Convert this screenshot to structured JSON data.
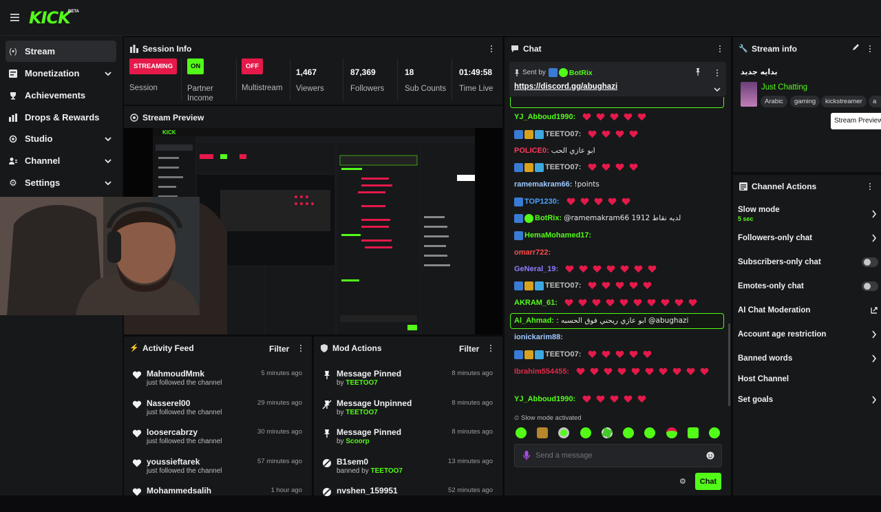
{
  "brand": {
    "logo": "KICK",
    "beta": "BETA"
  },
  "sidebar": {
    "items": [
      {
        "label": "Stream",
        "icon": "stream-icon"
      },
      {
        "label": "Monetization",
        "icon": "monetization-icon"
      },
      {
        "label": "Achievements",
        "icon": "trophy-icon"
      },
      {
        "label": "Drops & Rewards",
        "icon": "drops-icon"
      },
      {
        "label": "Studio",
        "icon": "studio-icon"
      },
      {
        "label": "Channel",
        "icon": "channel-icon"
      },
      {
        "label": "Settings",
        "icon": "gear-icon"
      }
    ]
  },
  "session": {
    "title": "Session Info",
    "stats": [
      {
        "badge": "STREAMING",
        "label": "Session"
      },
      {
        "badge": "ON",
        "label": "Partner Income"
      },
      {
        "badge": "OFF",
        "label": "Multistream"
      },
      {
        "value": "1,467",
        "label": "Viewers"
      },
      {
        "value": "87,369",
        "label": "Followers"
      },
      {
        "value": "18",
        "label": "Sub Counts"
      },
      {
        "value": "01:49:58",
        "label": "Time Live"
      }
    ]
  },
  "preview": {
    "title": "Stream Preview"
  },
  "activity": {
    "title": "Activity Feed",
    "filter": "Filter",
    "rows": [
      {
        "name": "MahmoudMmk",
        "sub": "just followed the channel",
        "time": "5 minutes ago"
      },
      {
        "name": "Nasserel00",
        "sub": "just followed the channel",
        "time": "29 minutes ago"
      },
      {
        "name": "loosercabrzy",
        "sub": "just followed the channel",
        "time": "30 minutes ago"
      },
      {
        "name": "youssieftarek",
        "sub": "just followed the channel",
        "time": "57 minutes ago"
      },
      {
        "name": "Mohammedsalih",
        "sub": "",
        "time": "1 hour ago"
      }
    ]
  },
  "mod": {
    "title": "Mod Actions",
    "filter": "Filter",
    "rows": [
      {
        "name": "Message Pinned",
        "by": "by",
        "who": "TEETOO7",
        "time": "8 minutes ago"
      },
      {
        "name": "Message Unpinned",
        "by": "by",
        "who": "TEETOO7",
        "time": "8 minutes ago"
      },
      {
        "name": "Message Pinned",
        "by": "by",
        "who": "Scoorp",
        "time": "8 minutes ago"
      },
      {
        "name": "B1sem0",
        "by": "banned by",
        "who": "TEETOO7",
        "time": "13 minutes ago"
      },
      {
        "name": "nvshen_159951",
        "by": "",
        "who": "",
        "time": "52 minutes ago"
      }
    ]
  },
  "chat": {
    "title": "Chat",
    "pinned": {
      "sent_by": "Sent by",
      "user": "BotRix",
      "link": "https://discord.gg/abughazi"
    },
    "messages": [
      {
        "user": "YJ_Abboud1990:",
        "text": "",
        "hearts": 5,
        "color": "#53fc18"
      },
      {
        "user": "TEETO07:",
        "text": "",
        "hearts": 4,
        "color": "#c0c0c0"
      },
      {
        "user": "POLICE0:",
        "text": "ابو عازي الحب",
        "hearts": 0,
        "color": "#ff3b5c"
      },
      {
        "user": "TEETO07:",
        "text": "",
        "hearts": 4,
        "color": "#c0c0c0"
      },
      {
        "user": "ramemakram66:",
        "text": "!points",
        "hearts": 0,
        "color": "#9fc8ff"
      },
      {
        "user": "TOP1230:",
        "text": "",
        "hearts": 5,
        "color": "#4aa3ff"
      },
      {
        "user": "BotRix:",
        "text": "@ramemakram66 لديه نقاط 1912",
        "hearts": 0,
        "color": "#53fc18"
      },
      {
        "user": "HemaMohamed17:",
        "text": "",
        "hearts": 0,
        "color": "#53fc18"
      },
      {
        "user": "omarr722:",
        "text": "",
        "hearts": 0,
        "color": "#ff4d4d"
      },
      {
        "user": "GeNeral_19:",
        "text": "",
        "hearts": 7,
        "color": "#8c7dff"
      },
      {
        "user": "TEETO07:",
        "text": "",
        "hearts": 5,
        "color": "#c0c0c0"
      },
      {
        "user": "AKRAM_61:",
        "text": "",
        "hearts": 10,
        "color": "#53fc18"
      },
      {
        "user": "Al_Ahmad:",
        "text": ": ابو عازي ريحني فوق الحسبه @abughazi",
        "hearts": 0,
        "color": "#53fc18"
      },
      {
        "user": "ionickarim88:",
        "text": "",
        "hearts": 0,
        "color": "#9fc8ff"
      },
      {
        "user": "TEETO07:",
        "text": "",
        "hearts": 5,
        "color": "#c0c0c0"
      },
      {
        "user": "Ibrahim554455:",
        "text": "",
        "hearts": 10,
        "color": "#e0284a"
      },
      {
        "user": "YJ_Abboud1990:",
        "text": "",
        "hearts": 5,
        "color": "#53fc18"
      }
    ],
    "slow_mode": "Slow mode activated",
    "input_placeholder": "Send a message",
    "send": "Chat"
  },
  "stream_info": {
    "title": "Stream info",
    "stream_title": "بدايه جديد",
    "category": "Just Chatting",
    "tags": [
      "Arabic",
      "gaming",
      "kickstreamer",
      "a"
    ],
    "tooltip": "Stream Preview"
  },
  "channel_actions": {
    "title": "Channel Actions",
    "items": [
      {
        "label": "Slow mode",
        "sub": "5 sec",
        "control": "chevron"
      },
      {
        "label": "Followers-only chat",
        "control": "chevron"
      },
      {
        "label": "Subscribers-only chat",
        "control": "toggle"
      },
      {
        "label": "Emotes-only chat",
        "control": "toggle"
      },
      {
        "label": "AI Chat Moderation",
        "control": "external"
      },
      {
        "label": "Account age restriction",
        "control": "chevron"
      },
      {
        "label": "Banned words",
        "control": "chevron"
      },
      {
        "label": "Host Channel",
        "control": "none"
      },
      {
        "label": "Set goals",
        "control": "chevron"
      }
    ]
  },
  "colors": {
    "accent": "#53fc18",
    "streaming": "#e5194a",
    "panel": "#17181a",
    "bg": "#0b0b0d"
  }
}
